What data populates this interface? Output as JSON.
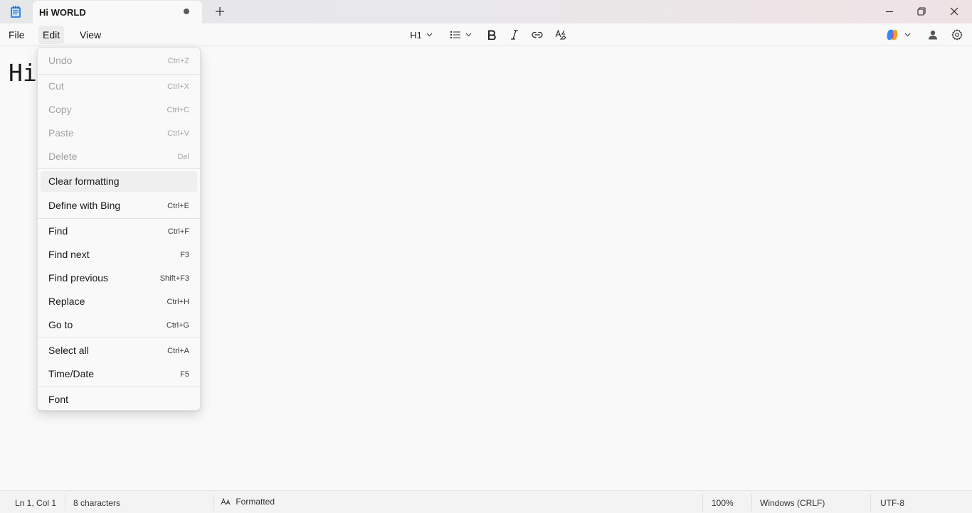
{
  "window": {
    "tab_title": "Hi WORLD"
  },
  "menu": {
    "file": "File",
    "edit": "Edit",
    "view": "View"
  },
  "toolbar": {
    "heading": "H1"
  },
  "editor": {
    "text": "Hi"
  },
  "edit_menu": {
    "items": [
      {
        "label": "Undo",
        "shortcut": "Ctrl+Z",
        "enabled": false
      },
      {
        "label": "Cut",
        "shortcut": "Ctrl+X",
        "enabled": false
      },
      {
        "label": "Copy",
        "shortcut": "Ctrl+C",
        "enabled": false
      },
      {
        "label": "Paste",
        "shortcut": "Ctrl+V",
        "enabled": false
      },
      {
        "label": "Delete",
        "shortcut": "Del",
        "enabled": false
      },
      {
        "label": "Clear formatting",
        "shortcut": "",
        "enabled": true,
        "hovered": true
      },
      {
        "label": "Define with Bing",
        "shortcut": "Ctrl+E",
        "enabled": true
      },
      {
        "label": "Find",
        "shortcut": "Ctrl+F",
        "enabled": true
      },
      {
        "label": "Find next",
        "shortcut": "F3",
        "enabled": true
      },
      {
        "label": "Find previous",
        "shortcut": "Shift+F3",
        "enabled": true
      },
      {
        "label": "Replace",
        "shortcut": "Ctrl+H",
        "enabled": true
      },
      {
        "label": "Go to",
        "shortcut": "Ctrl+G",
        "enabled": true
      },
      {
        "label": "Select all",
        "shortcut": "Ctrl+A",
        "enabled": true
      },
      {
        "label": "Time/Date",
        "shortcut": "F5",
        "enabled": true
      },
      {
        "label": "Font",
        "shortcut": "",
        "enabled": true
      }
    ]
  },
  "status": {
    "position": "Ln 1, Col 1",
    "characters": "8 characters",
    "format": "Formatted",
    "zoom": "100%",
    "line_ending": "Windows (CRLF)",
    "encoding": "UTF-8"
  },
  "colors": {
    "app_icon": "#3a86d8",
    "copilot_a": "#2e8cf0",
    "copilot_b": "#f0a21e",
    "copilot_c": "#c43ec4"
  }
}
